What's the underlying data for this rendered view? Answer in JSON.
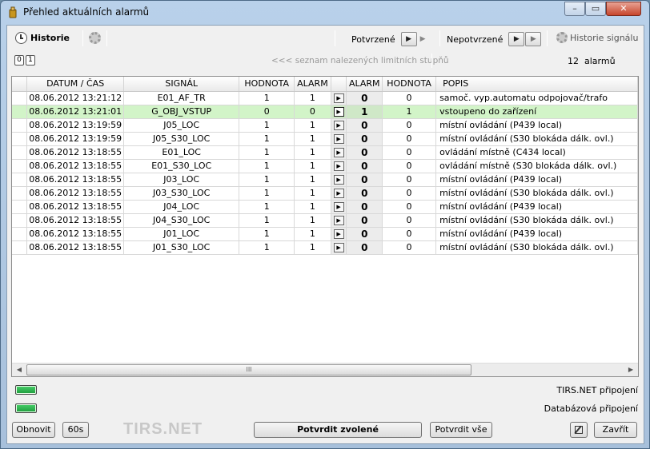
{
  "window": {
    "title": "Přehled aktuálních alarmů"
  },
  "toolbar": {
    "historie_label": "Historie",
    "potvrzene_label": "Potvrzené",
    "nepotvrzene_label": "Nepotvrzené",
    "historie_signalu_label": "Historie signálu"
  },
  "statusline": {
    "counter_a": "0",
    "counter_b": "1",
    "list_label": "<<<  seznam nalezených limitních stupňů",
    "count": "12",
    "count_unit": "alarmů"
  },
  "table": {
    "headers": [
      "DATUM / ČAS",
      "SIGNÁL",
      "HODNOTA",
      "ALARM",
      "",
      "ALARM",
      "HODNOTA",
      "POPIS"
    ],
    "rows": [
      {
        "dt": "08.06.2012 13:21:12",
        "signal": "E01_AF_TR",
        "val1": "1",
        "alarm1": "1",
        "alarm2": "0",
        "val2": "0",
        "desc": "samoč. vyp.automatu odpojovač/trafo"
      },
      {
        "dt": "08.06.2012 13:21:01",
        "signal": "G_OBJ_VSTUP",
        "val1": "0",
        "alarm1": "0",
        "alarm2": "1",
        "val2": "1",
        "desc": "vstoupeno do zařízení"
      },
      {
        "dt": "08.06.2012 13:19:59",
        "signal": "J05_LOC",
        "val1": "1",
        "alarm1": "1",
        "alarm2": "0",
        "val2": "0",
        "desc": "místní ovládání (P439 local)"
      },
      {
        "dt": "08.06.2012 13:19:59",
        "signal": "J05_S30_LOC",
        "val1": "1",
        "alarm1": "1",
        "alarm2": "0",
        "val2": "0",
        "desc": "místní ovládání (S30 blokáda dálk. ovl.)"
      },
      {
        "dt": "08.06.2012 13:18:55",
        "signal": "E01_LOC",
        "val1": "1",
        "alarm1": "1",
        "alarm2": "0",
        "val2": "0",
        "desc": "ovládání místně (C434 local)"
      },
      {
        "dt": "08.06.2012 13:18:55",
        "signal": "E01_S30_LOC",
        "val1": "1",
        "alarm1": "1",
        "alarm2": "0",
        "val2": "0",
        "desc": "ovládání místně (S30 blokáda dálk. ovl.)"
      },
      {
        "dt": "08.06.2012 13:18:55",
        "signal": "J03_LOC",
        "val1": "1",
        "alarm1": "1",
        "alarm2": "0",
        "val2": "0",
        "desc": "místní ovládání (P439 local)"
      },
      {
        "dt": "08.06.2012 13:18:55",
        "signal": "J03_S30_LOC",
        "val1": "1",
        "alarm1": "1",
        "alarm2": "0",
        "val2": "0",
        "desc": "místní ovládání (S30 blokáda dálk. ovl.)"
      },
      {
        "dt": "08.06.2012 13:18:55",
        "signal": "J04_LOC",
        "val1": "1",
        "alarm1": "1",
        "alarm2": "0",
        "val2": "0",
        "desc": "místní ovládání (P439 local)"
      },
      {
        "dt": "08.06.2012 13:18:55",
        "signal": "J04_S30_LOC",
        "val1": "1",
        "alarm1": "1",
        "alarm2": "0",
        "val2": "0",
        "desc": "místní ovládání (S30 blokáda dálk. ovl.)"
      },
      {
        "dt": "08.06.2012 13:18:55",
        "signal": "J01_LOC",
        "val1": "1",
        "alarm1": "1",
        "alarm2": "0",
        "val2": "0",
        "desc": "místní ovládání (P439 local)"
      },
      {
        "dt": "08.06.2012 13:18:55",
        "signal": "J01_S30_LOC",
        "val1": "1",
        "alarm1": "1",
        "alarm2": "0",
        "val2": "0",
        "desc": "místní ovládání (S30 blokáda dálk. ovl.)"
      }
    ],
    "highlighted_row": 1,
    "scroll_grip": "III"
  },
  "connections": {
    "tirs_label": "TIRS.NET připojení",
    "db_label": "Databázová připojení",
    "status_color": "#27b04a"
  },
  "footer": {
    "refresh_label": "Obnovit",
    "interval_label": "60s",
    "brand": "TIRS.NET",
    "confirm_selected_label": "Potvrdit zvolené",
    "confirm_all_label": "Potvrdit vše",
    "close_label": "Zavřít"
  }
}
